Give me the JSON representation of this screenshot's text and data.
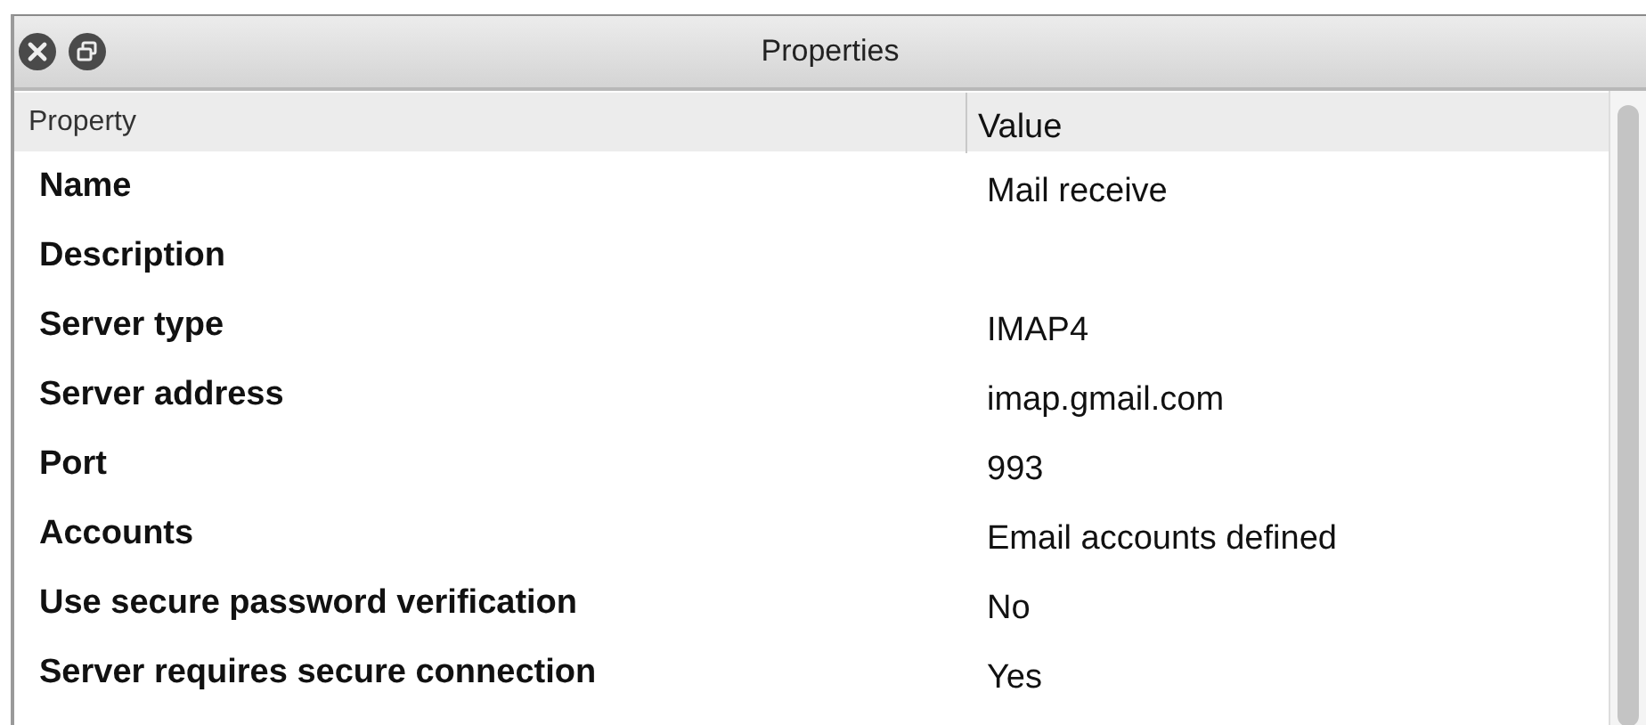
{
  "window": {
    "title": "Properties"
  },
  "table": {
    "columns": [
      "Property",
      "Value"
    ],
    "rows": [
      {
        "property": "Name",
        "value": "Mail receive"
      },
      {
        "property": "Description",
        "value": ""
      },
      {
        "property": "Server type",
        "value": "IMAP4"
      },
      {
        "property": "Server address",
        "value": "imap.gmail.com"
      },
      {
        "property": "Port",
        "value": "993"
      },
      {
        "property": "Accounts",
        "value": "Email accounts defined"
      },
      {
        "property": "Use secure password verification",
        "value": "No"
      },
      {
        "property": "Server requires secure connection",
        "value": "Yes"
      }
    ]
  }
}
